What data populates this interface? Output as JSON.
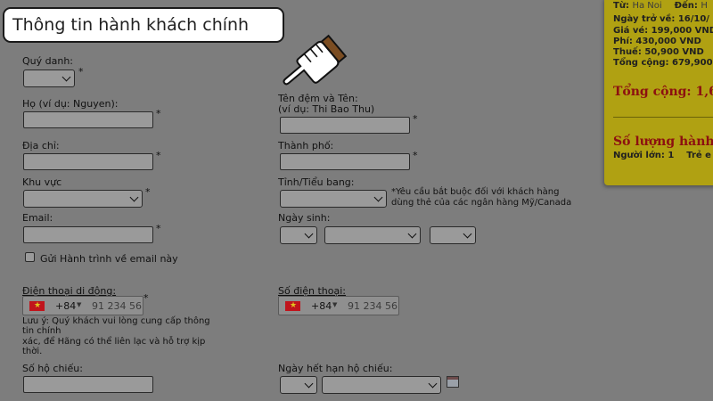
{
  "callout": {
    "text": "Thông tin hành khách chính"
  },
  "form": {
    "title_label": "Quý danh:",
    "required_mark": "*",
    "last_name_label": "Họ (ví dụ: Nguyen):",
    "first_middle_label_line1": "Tên đệm và Tên:",
    "first_middle_label_line2": "(ví dụ: Thi Bao Thu)",
    "address_label": "Địa chỉ:",
    "city_label": "Thành phố:",
    "region_label": "Khu vực",
    "state_label": "Tỉnh/Tiểu bang:",
    "state_note_line1": "*Yêu cầu bắt buộc đối với khách hàng",
    "state_note_line2": "dùng thẻ của các ngân hàng Mỹ/Canada",
    "email_label": "Email:",
    "dob_label": "Ngày sinh:",
    "send_itinerary_label": "Gửi Hành trình về email này",
    "send_itinerary_checked": false,
    "mobile_label": "Điện thoại di động:",
    "phone_label": "Số điện thoại:",
    "country_code": "+84",
    "phone_placeholder": "91 234 56",
    "mobile_note_line1": "Lưu ý: Quý khách vui lòng cung cấp thông",
    "mobile_note_line2": "tin chính",
    "mobile_note_line3": "xác, để Hãng có thể liên lạc và hỗ trợ kịp",
    "mobile_note_line4": "thời.",
    "passport_label": "Số hộ chiếu:",
    "passport_expiry_label": "Ngày hết hạn hộ chiếu:"
  },
  "summary": {
    "from_label": "Từ:",
    "from_value": "Ha Noi",
    "to_label": "Đến:",
    "to_value": "H",
    "return_date": "Ngày trở về: 16/10/",
    "fare": "Giá vé: 199,000 VND",
    "fee": "Phí: 430,000 VND",
    "tax": "Thuế: 50,900 VND",
    "subtotal": "Tổng cộng: 679,900",
    "total_label": "Tổng cộng: 1,6",
    "passenger_count_title": "Số lượng hành",
    "adults": "Người lớn: 1",
    "children": "Trẻ e"
  },
  "colors": {
    "overlay_bg": "#7d7d7d",
    "panel_bg": "#b0a112",
    "total_red": "#8c1010",
    "flag_red": "#c0141c"
  },
  "icons": [
    "pointing-hand-icon",
    "vietnam-flag-icon",
    "calendar-icon",
    "chevron-down-icon"
  ]
}
